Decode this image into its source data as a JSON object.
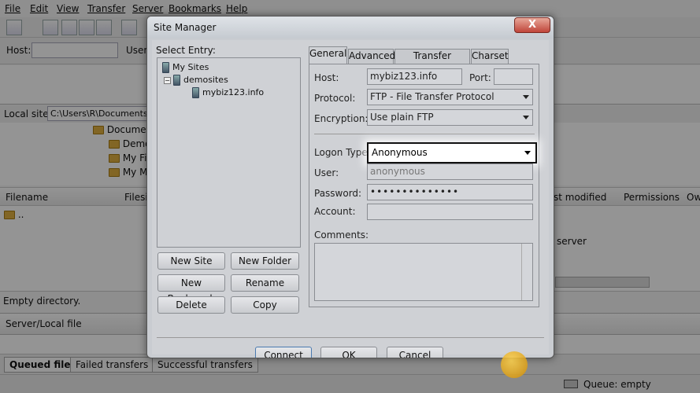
{
  "app": {
    "menu": [
      "File",
      "Edit",
      "View",
      "Transfer",
      "Server",
      "Bookmarks",
      "Help"
    ],
    "quickconnect": {
      "host_label": "Host:",
      "user_label": "Userr"
    },
    "local_site": {
      "label": "Local site:",
      "path": "C:\\Users\\R\\Documents\\W"
    },
    "tree": [
      "Docume",
      "Demo",
      "My Fi",
      "My M"
    ],
    "file_columns": {
      "filename": "Filename",
      "filesize": "Filesi",
      "last_modified": "st modified",
      "permissions": "Permissions",
      "owner": "Ow"
    },
    "file_rows": [
      ".."
    ],
    "status": "Empty directory.",
    "remote_status": "server",
    "queue_header": "Server/Local file",
    "queue_tabs": [
      "Queued files",
      "Failed transfers",
      "Successful transfers"
    ],
    "queue_status": "Queue: empty"
  },
  "dialog": {
    "title": "Site Manager",
    "close_label": "X",
    "select_entry_label": "Select Entry:",
    "tree": {
      "root": "My Sites",
      "folder": "demosites",
      "site": "mybiz123.info"
    },
    "buttons": {
      "new_site": "New Site",
      "new_folder": "New Folder",
      "new_bookmark": "New Bookmark",
      "rename": "Rename",
      "delete": "Delete",
      "copy": "Copy",
      "connect": "Connect",
      "ok": "OK",
      "cancel": "Cancel"
    },
    "tabs": [
      "General",
      "Advanced",
      "Transfer Settings",
      "Charset"
    ],
    "general": {
      "host_label": "Host:",
      "host_value": "mybiz123.info",
      "port_label": "Port:",
      "port_value": "",
      "protocol_label": "Protocol:",
      "protocol_value": "FTP - File Transfer Protocol",
      "encryption_label": "Encryption:",
      "encryption_value": "Use plain FTP",
      "logon_type_label": "Logon Type:",
      "logon_type_value": "Anonymous",
      "user_label": "User:",
      "user_value": "anonymous",
      "password_label": "Password:",
      "password_value": "••••••••••••••",
      "account_label": "Account:",
      "account_value": "",
      "comments_label": "Comments:"
    }
  }
}
